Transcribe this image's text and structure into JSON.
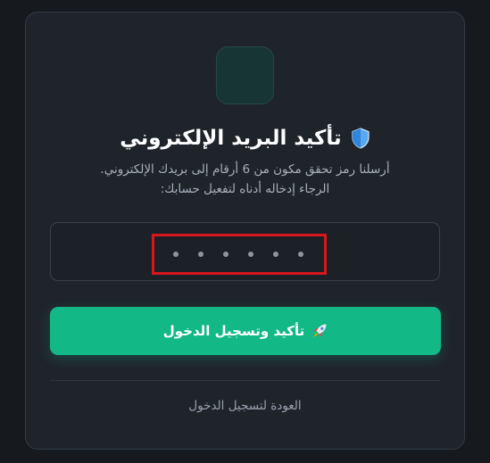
{
  "verify": {
    "title": "تأكيد البريد الإلكتروني",
    "description_line1": "أرسلنا رمز تحقق مكون من 6 أرقام إلى بريدك الإلكتروني.",
    "description_line2": "الرجاء إدخاله أدناه لتفعيل حسابك:",
    "otp_length": 6,
    "submit_label": "تأكيد وتسجيل الدخول",
    "back_label": "العودة لتسجيل الدخول"
  },
  "icons": {
    "title_icon": "shield-icon",
    "submit_icon": "rocket-icon"
  },
  "colors": {
    "accent": "#12b886",
    "annotation": "#d8161d",
    "card_background": "#1f242b"
  }
}
